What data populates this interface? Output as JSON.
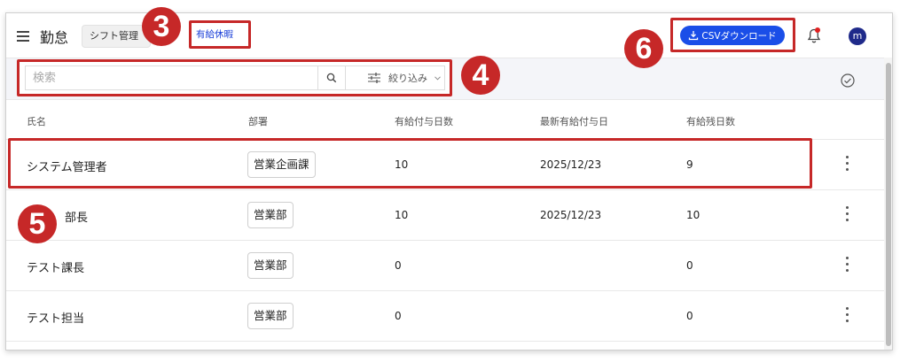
{
  "header": {
    "app_title": "勤怠",
    "tabs": [
      {
        "label": "シフト管理"
      },
      {
        "label": "有給休暇"
      }
    ],
    "csv_button_label": "CSVダウンロード",
    "avatar_initial": "m"
  },
  "toolbar": {
    "search_placeholder": "検索",
    "filter_label": "絞り込み"
  },
  "table": {
    "headers": [
      "氏名",
      "部署",
      "有給付与日数",
      "最新有給付与日",
      "有給残日数"
    ],
    "rows": [
      {
        "name": "システム管理者",
        "dept": "営業企画課",
        "granted": "10",
        "latest_date": "2025/12/23",
        "remaining": "9"
      },
      {
        "name": "部長",
        "dept": "営業部",
        "granted": "10",
        "latest_date": "2025/12/23",
        "remaining": "10"
      },
      {
        "name": "テスト課長",
        "dept": "営業部",
        "granted": "0",
        "latest_date": "",
        "remaining": "0"
      },
      {
        "name": "テスト担当",
        "dept": "営業部",
        "granted": "0",
        "latest_date": "",
        "remaining": "0"
      }
    ]
  },
  "callouts": [
    "3",
    "4",
    "5",
    "6"
  ],
  "colors": {
    "accent": "#1a4ee8",
    "annotation": "#c62828",
    "avatar": "#1f2a8a"
  }
}
